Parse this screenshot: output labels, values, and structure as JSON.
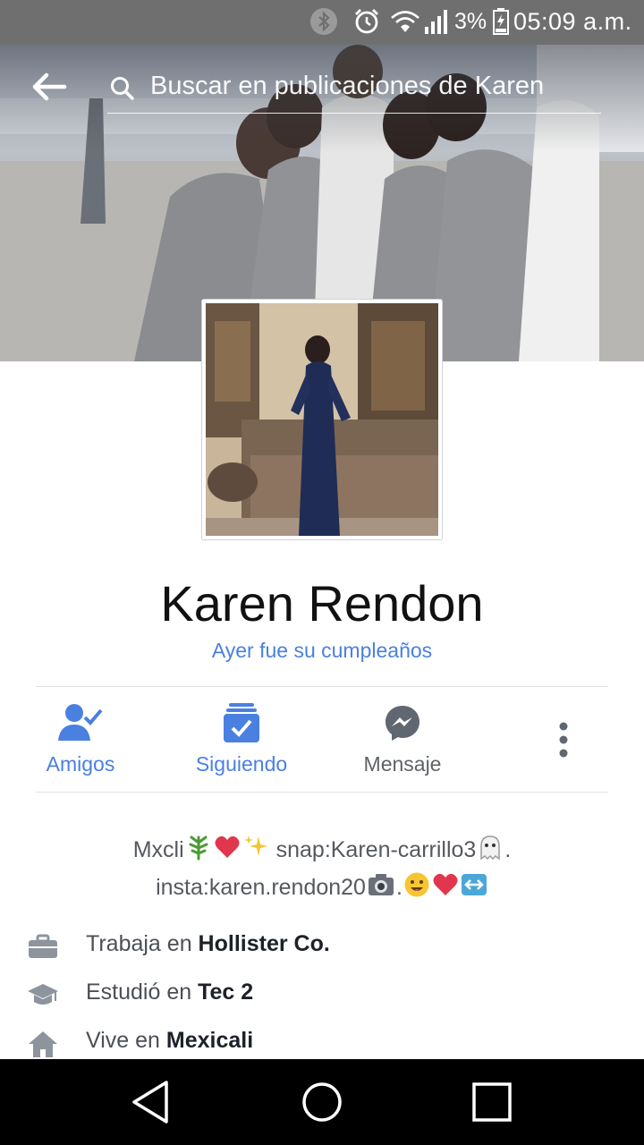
{
  "status_bar": {
    "battery_percent": "3%",
    "time": "05:09 a.m.",
    "icons": [
      "bluetooth-icon",
      "alarm-icon",
      "wifi-icon",
      "signal-icon",
      "battery-icon"
    ]
  },
  "search": {
    "placeholder": "Buscar en publicaciones de Karen"
  },
  "profile": {
    "name": "Karen Rendon",
    "birthday_note": "Ayer fue su cumpleaños"
  },
  "actions": [
    {
      "label": "Amigos",
      "icon": "friends-check-icon",
      "color": "#4a80e0"
    },
    {
      "label": "Siguiendo",
      "icon": "following-check-icon",
      "color": "#4a80e0"
    },
    {
      "label": "Mensaje",
      "icon": "messenger-icon",
      "color": "#5f6368"
    }
  ],
  "bio": {
    "line1_a": "Mxcli",
    "line1_b": " snap:Karen-carrillo3",
    "line1_c": ".",
    "line2_a": "insta:karen.rendon20",
    "line2_b": "."
  },
  "details": [
    {
      "prefix": "Trabaja en ",
      "value": "Hollister Co.",
      "icon": "briefcase-icon"
    },
    {
      "prefix": "Estudió en ",
      "value": "Tec 2",
      "icon": "graduation-cap-icon"
    },
    {
      "prefix": "Vive en ",
      "value": "Mexicali",
      "icon": "home-icon"
    }
  ],
  "colors": {
    "accent": "#4a80e0",
    "status_bar": "#6f6f6f",
    "text_secondary": "#4b4f56"
  }
}
